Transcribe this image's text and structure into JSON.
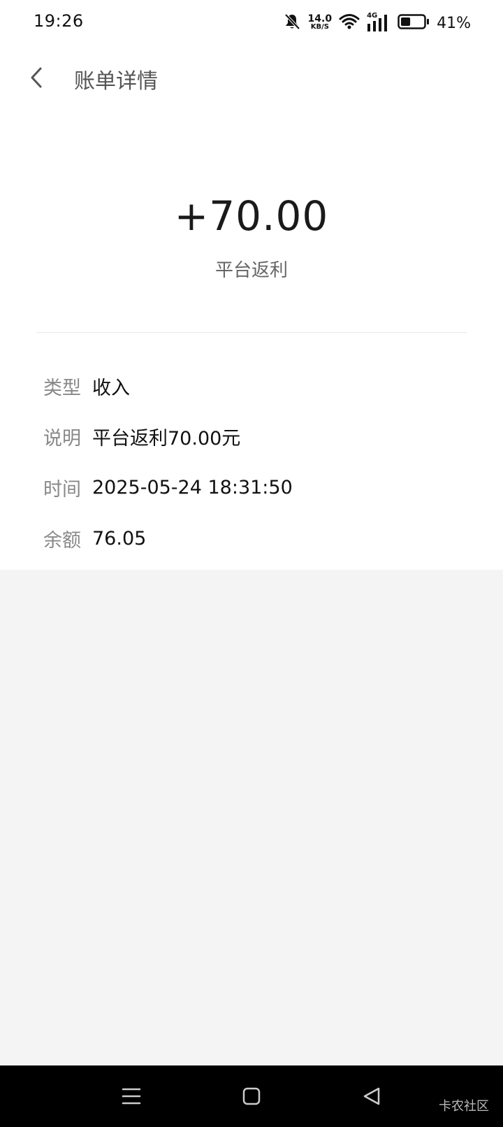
{
  "status_bar": {
    "time": "19:26",
    "net_speed_value": "14.0",
    "net_speed_unit": "KB/S",
    "network_type": "4G",
    "battery_percent": "41%",
    "battery_level": 0.41
  },
  "header": {
    "title": "账单详情"
  },
  "bill": {
    "amount": "+70.00",
    "description": "平台返利",
    "details": [
      {
        "label": "类型",
        "value": "收入"
      },
      {
        "label": "说明",
        "value": "平台返利70.00元"
      },
      {
        "label": "时间",
        "value": "2025-05-24 18:31:50"
      },
      {
        "label": "余额",
        "value": "76.05"
      }
    ]
  },
  "watermark": "卡农社区",
  "colors": {
    "background": "#f4f4f4",
    "card": "#ffffff",
    "nav_bar": "#000000"
  }
}
